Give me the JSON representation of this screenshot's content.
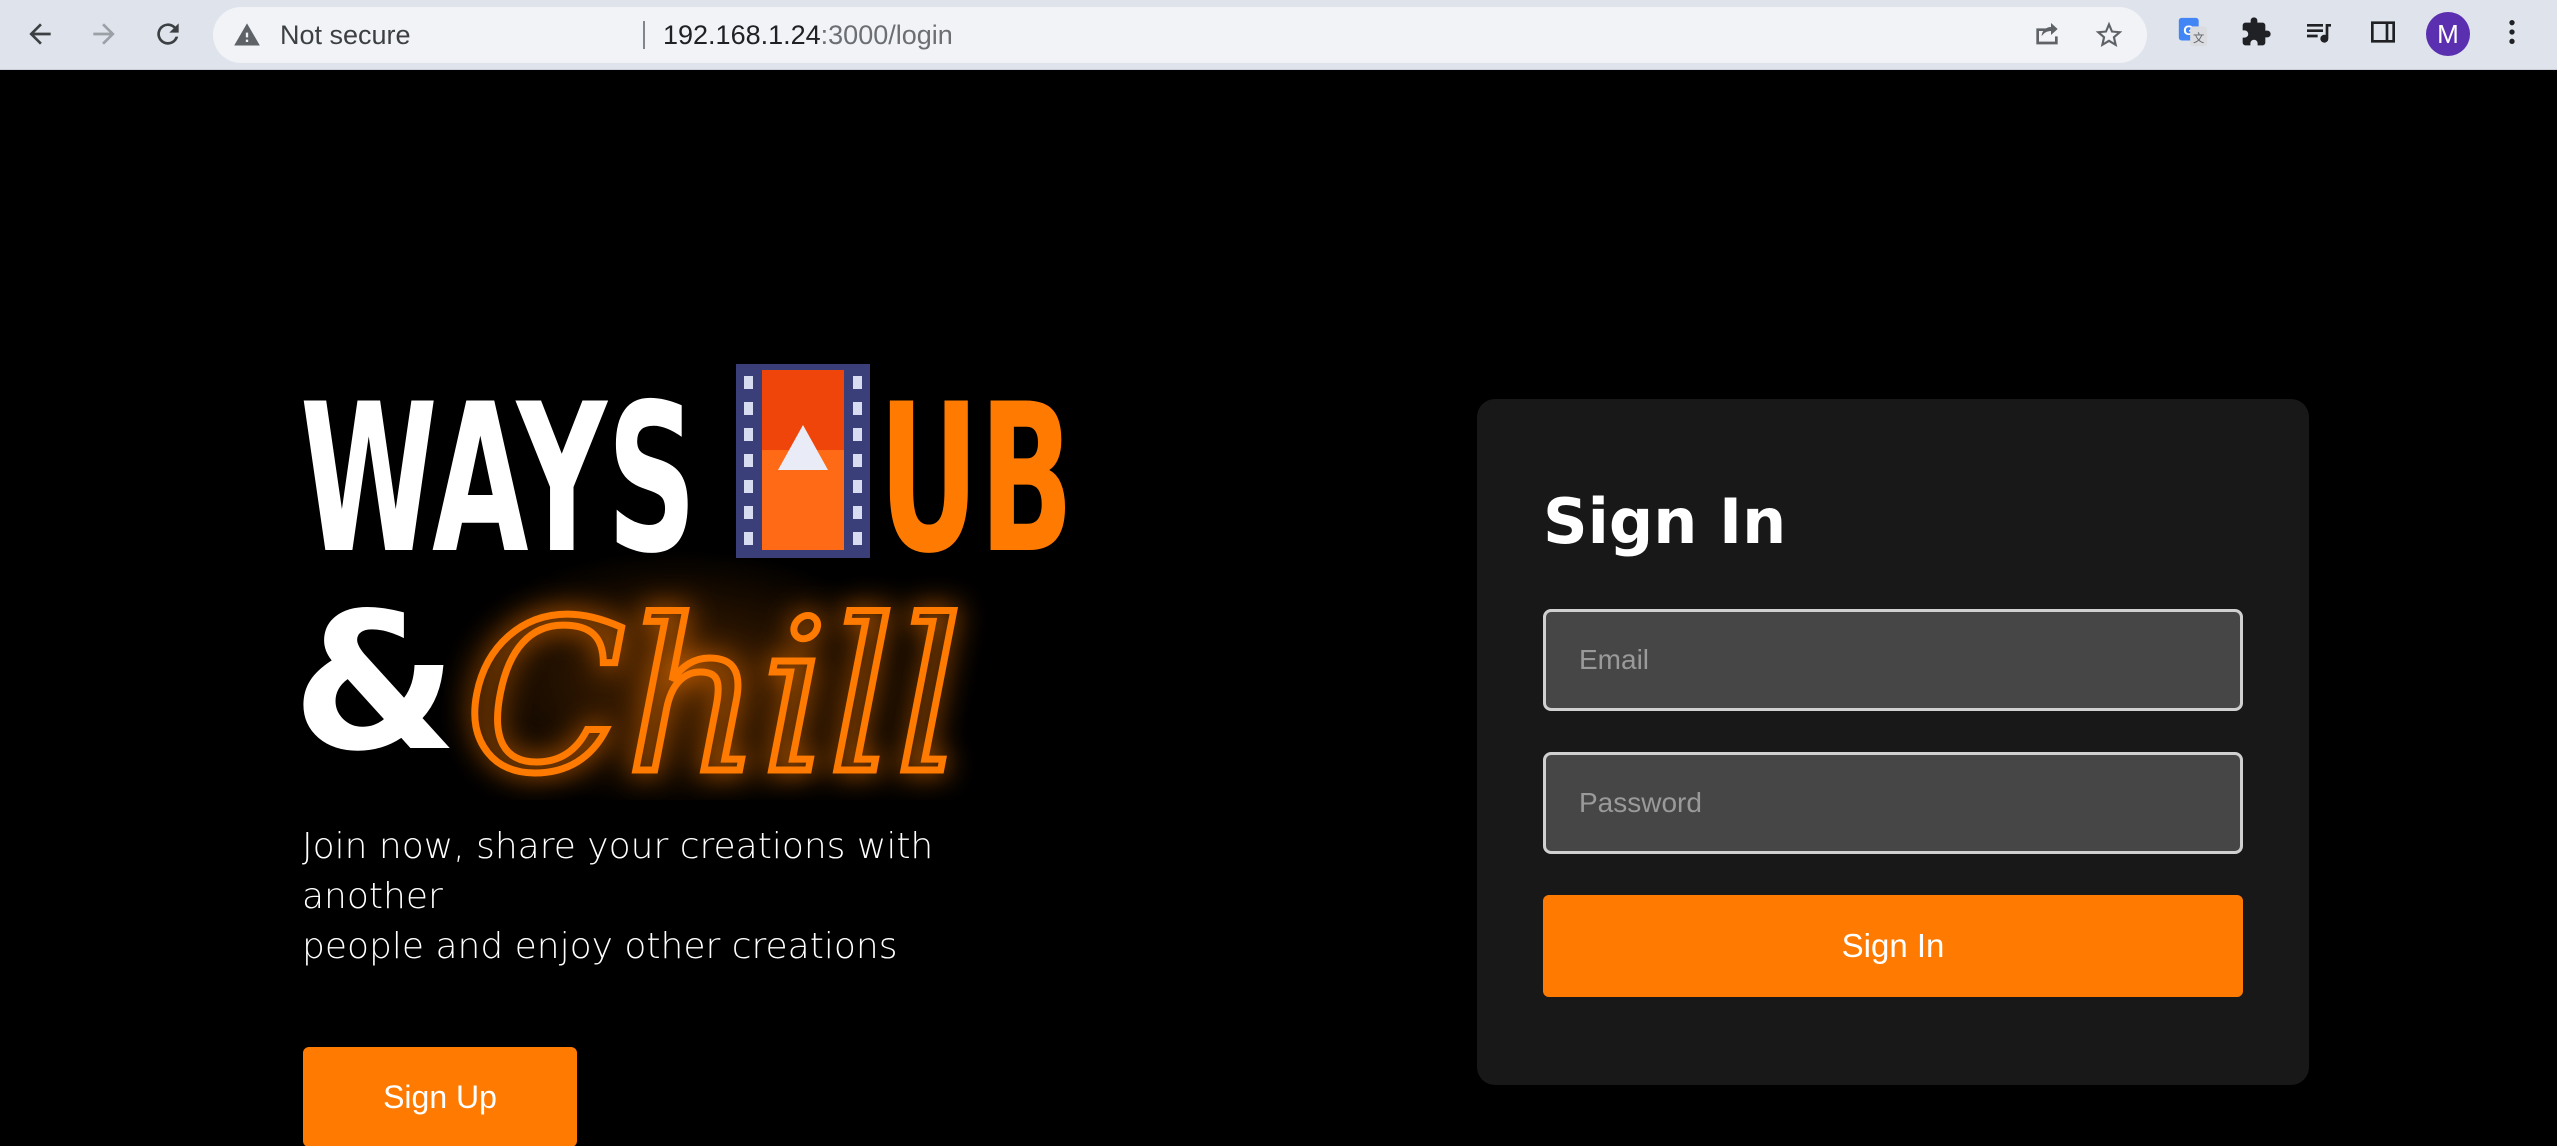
{
  "browser": {
    "security_label": "Not secure",
    "url_host": "192.168.1.24",
    "url_rest": ":3000/login",
    "profile_initial": "M"
  },
  "brand": {
    "logo_line1_left": "WAYS",
    "logo_line1_right": "UB",
    "logo_line2_amp": "&",
    "logo_line2_script": "Chill"
  },
  "hero": {
    "tagline_line1": "Join now, share your creations with another",
    "tagline_line2": "people and enjoy other creations",
    "signup_label": "Sign Up"
  },
  "signin": {
    "title": "Sign In",
    "email_placeholder": "Email",
    "password_placeholder": "Password",
    "submit_label": "Sign In"
  },
  "colors": {
    "accent": "#ff7a00",
    "background": "#000000",
    "card": "#181818",
    "input": "#464646"
  }
}
